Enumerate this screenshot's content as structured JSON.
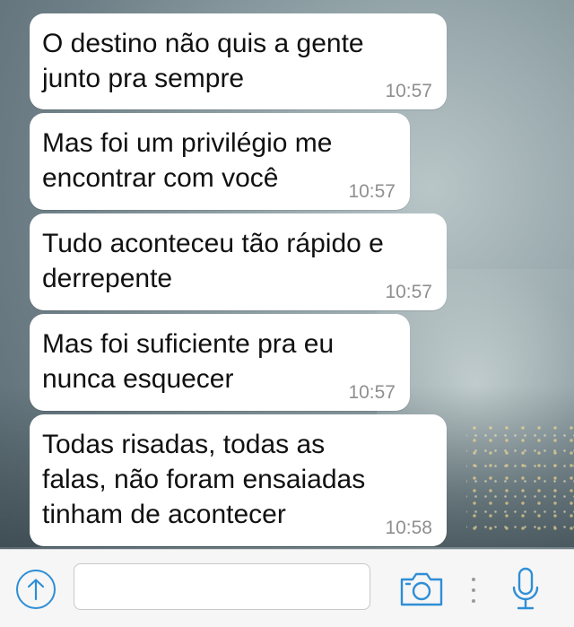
{
  "chat": {
    "messages": [
      {
        "text": "O destino não quis a gente\njunto pra sempre",
        "time": "10:57"
      },
      {
        "text": "Mas foi um privilégio me\nencontrar com você",
        "time": "10:57"
      },
      {
        "text": "Tudo aconteceu tão rápido e\nderrepente",
        "time": "10:57"
      },
      {
        "text": "Mas foi suficiente pra eu\nnunca esquecer",
        "time": "10:57"
      },
      {
        "text": "Todas risadas, todas as\nfalas, não foram ensaiadas\ntinham de acontecer",
        "time": "10:58"
      }
    ]
  },
  "input_bar": {
    "message_value": "",
    "icons": {
      "upload": "arrow-up-circle-icon",
      "camera": "camera-icon",
      "more": "vertical-dots-icon",
      "microphone": "microphone-icon"
    }
  },
  "colors": {
    "accent": "#2e8ed6",
    "bubble": "#ffffff",
    "timestamp": "#8f8f8f",
    "input_bar": "#f6f6f6"
  }
}
